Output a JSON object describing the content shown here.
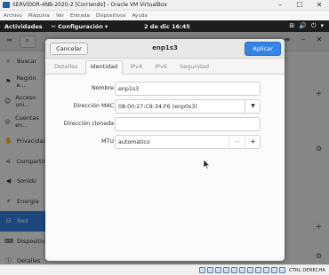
{
  "vbox": {
    "title": "SERVIDOR-4NB-2020-2 [Corriendo] - Oracle VM VirtualBox",
    "window_controls": [
      "–",
      "☐",
      "✕"
    ],
    "menu": [
      "Archivo",
      "Máquina",
      "Ver",
      "Entrada",
      "Dispositivos",
      "Ayuda"
    ],
    "host_key": "CTRL DERECHA"
  },
  "topbar": {
    "activities": "Actividades",
    "app_menu": "Configuración",
    "clock": "2 de dic  16:45",
    "tray": [
      "⊞",
      "🔊",
      "⏻",
      "▾"
    ]
  },
  "settings": {
    "sidebar": [
      {
        "icon": "search-icon",
        "glyph": "⌕",
        "label": "Buscar"
      },
      {
        "icon": "region-icon",
        "glyph": "⚑",
        "label": "Región e..."
      },
      {
        "icon": "accessibility-icon",
        "glyph": "☺",
        "label": "Acceso uni..."
      },
      {
        "icon": "accounts-icon",
        "glyph": "◎",
        "label": "Cuentas en..."
      },
      {
        "icon": "privacy-icon",
        "glyph": "✋",
        "label": "Privacidad"
      },
      {
        "icon": "share-icon",
        "glyph": "⋖",
        "label": "Compartir"
      },
      {
        "icon": "sound-icon",
        "glyph": "◀",
        "label": "Sonido"
      },
      {
        "icon": "power-icon",
        "glyph": "⚡",
        "label": "Energía"
      },
      {
        "icon": "network-icon",
        "glyph": "⊟",
        "label": "Red"
      },
      {
        "icon": "devices-icon",
        "glyph": "⌨",
        "label": "Dispositivo..."
      },
      {
        "icon": "details-icon",
        "glyph": "ⓘ",
        "label": "Detalles"
      }
    ],
    "active_index": 8
  },
  "dialog": {
    "cancel_label": "Cancelar",
    "title": "enp1s3",
    "apply_label": "Aplicar",
    "tabs": [
      "Detalles",
      "Identidad",
      "IPv4",
      "IPv6",
      "Seguridad"
    ],
    "active_tab": 1,
    "fields": {
      "name": {
        "label": "Nombre",
        "value": "enp1s3"
      },
      "mac": {
        "label": "Dirección MAC",
        "value": "08:00:27:C9:34:F6 (enp0s3)"
      },
      "cloned": {
        "label": "Dirección clonada",
        "value": ""
      },
      "mtu": {
        "label": "MTU",
        "value": "automático"
      }
    }
  },
  "colors": {
    "accent": "#3584e4",
    "topbar": "#1d1d1d"
  }
}
